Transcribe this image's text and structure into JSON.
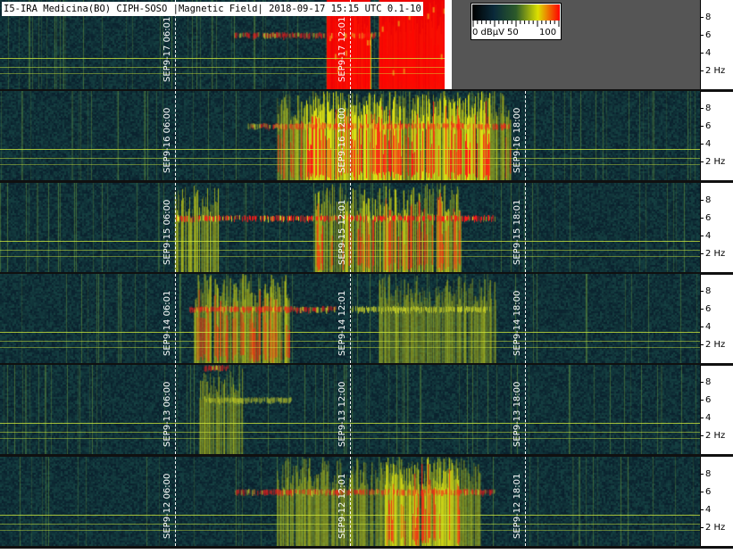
{
  "header": {
    "title": "I5-IRA Medicina(BO) CIPH-SOSO |Magnetic Field| 2018-09-17 15:15 UTC 0.1-10"
  },
  "legend": {
    "min_label": "0 dBµV",
    "mid_label": "50",
    "max_label": "100",
    "colors": [
      "#000000",
      "#0a2a3a",
      "#2c5a2a",
      "#dde000",
      "#ff0000"
    ]
  },
  "colors": {
    "background": "#0e2a3b",
    "low": "#274f3a",
    "mid": "#c7d411",
    "high": "#ff1a1a",
    "guide": "#d2eb3c",
    "gap": "#555555"
  },
  "chart_data": {
    "type": "heatmap",
    "title": "I5-IRA Medicina(BO) CIPH-SOSO |Magnetic Field| 2018-09-17 15:15 UTC 0.1-10",
    "xlabel": "",
    "ylabel": "Hz",
    "ylim": [
      0,
      10
    ],
    "y_ticks": [
      {
        "value": 8,
        "label": "8"
      },
      {
        "value": 6,
        "label": "6"
      },
      {
        "value": 4,
        "label": "4"
      },
      {
        "value": 2,
        "label": "2 Hz"
      }
    ],
    "colorbar": {
      "unit": "dBµV",
      "range": [
        0,
        100
      ],
      "labels": [
        "0 dBµV",
        "50",
        "100"
      ]
    },
    "x_range_hours": [
      0,
      24
    ],
    "strips": [
      {
        "date": "SEP 17",
        "end_hour": 15.25,
        "markers": [
          {
            "hour": 6,
            "label": "SEP9-17 06:01"
          },
          {
            "hour": 12,
            "label": "SEP9-17 12:01"
          }
        ],
        "bursts": [
          {
            "start": 11.2,
            "end": 12.7,
            "intensity": 2.5
          },
          {
            "start": 13,
            "end": 15.25,
            "intensity": 3.2
          }
        ],
        "lines": [
          {
            "hz": 6,
            "start": 8.0,
            "end": 13.0,
            "intensity": 1.4
          }
        ]
      },
      {
        "date": "SEP 16",
        "end_hour": 24,
        "markers": [
          {
            "hour": 6,
            "label": "SEP9-16 06:00"
          },
          {
            "hour": 12,
            "label": "SEP9-16 12:00"
          },
          {
            "hour": 18,
            "label": "SEP9-16 18:00"
          }
        ],
        "bursts": [
          {
            "start": 9.5,
            "end": 17.5,
            "intensity": 1.4
          },
          {
            "start": 10.5,
            "end": 16.8,
            "intensity": 2.3
          }
        ],
        "lines": [
          {
            "hz": 6,
            "start": 8.5,
            "end": 17.5,
            "intensity": 1.6
          }
        ]
      },
      {
        "date": "SEP 15",
        "end_hour": 24,
        "markers": [
          {
            "hour": 6,
            "label": "SEP9-15 06:00"
          },
          {
            "hour": 12,
            "label": "SEP9-15 12:01"
          },
          {
            "hour": 18,
            "label": "SEP9-15 18:01"
          }
        ],
        "bursts": [
          {
            "start": 6,
            "end": 7.5,
            "intensity": 1.1
          },
          {
            "start": 10.8,
            "end": 15.8,
            "intensity": 1.7
          }
        ],
        "lines": [
          {
            "hz": 6,
            "start": 6.0,
            "end": 17.0,
            "intensity": 1.8
          }
        ]
      },
      {
        "date": "SEP 14",
        "end_hour": 24,
        "markers": [
          {
            "hour": 6,
            "label": "SEP9-14 06:01"
          },
          {
            "hour": 12,
            "label": "SEP9-14 12:01"
          },
          {
            "hour": 18,
            "label": "SEP9-14 18:00"
          }
        ],
        "bursts": [
          {
            "start": 6.6,
            "end": 10,
            "intensity": 1.9
          },
          {
            "start": 13,
            "end": 17,
            "intensity": 0.9
          }
        ],
        "lines": [
          {
            "hz": 6,
            "start": 6.5,
            "end": 11.5,
            "intensity": 2.2
          },
          {
            "hz": 6,
            "start": 12,
            "end": 16.8,
            "intensity": 1.0
          }
        ]
      },
      {
        "date": "SEP 13",
        "end_hour": 24,
        "markers": [
          {
            "hour": 6,
            "label": "SEP9-13 06:00"
          },
          {
            "hour": 12,
            "label": "SEP9-13 12:00"
          },
          {
            "hour": 18,
            "label": "SEP9-13 18:00"
          }
        ],
        "bursts": [
          {
            "start": 6.8,
            "end": 8.3,
            "intensity": 0.9
          }
        ],
        "lines": [
          {
            "hz": 6,
            "start": 7.0,
            "end": 10.0,
            "intensity": 1.0
          },
          {
            "hz": 9.6,
            "start": 7.0,
            "end": 7.8,
            "intensity": 2.0
          }
        ]
      },
      {
        "date": "SEP 12",
        "end_hour": 24,
        "markers": [
          {
            "hour": 6,
            "label": "SEP9-12 06:00"
          },
          {
            "hour": 12,
            "label": "SEP9-12 12:01"
          },
          {
            "hour": 18,
            "label": "SEP9-12 18:01"
          }
        ],
        "bursts": [
          {
            "start": 9.5,
            "end": 16.5,
            "intensity": 1.0
          },
          {
            "start": 13.2,
            "end": 15.8,
            "intensity": 2.2
          }
        ],
        "lines": [
          {
            "hz": 6,
            "start": 8,
            "end": 17,
            "intensity": 1.5
          }
        ]
      }
    ]
  }
}
